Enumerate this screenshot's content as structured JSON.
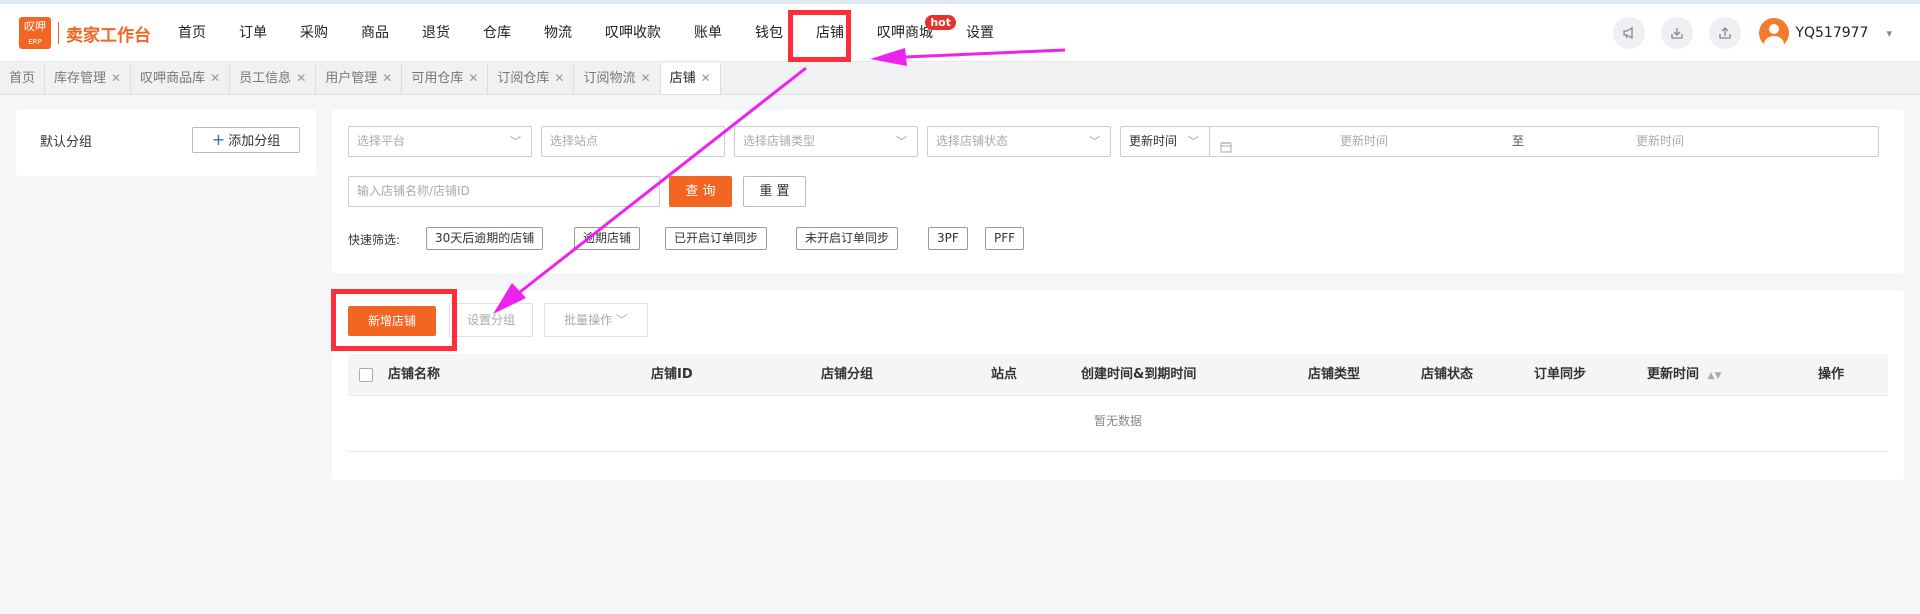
{
  "logo": {
    "mark_text": "叹呷",
    "mark_sub": "ERP",
    "title": "卖家工作台"
  },
  "nav": {
    "items": [
      {
        "label": "首页"
      },
      {
        "label": "订单"
      },
      {
        "label": "采购"
      },
      {
        "label": "商品"
      },
      {
        "label": "退货"
      },
      {
        "label": "仓库"
      },
      {
        "label": "物流"
      },
      {
        "label": "叹呷收款"
      },
      {
        "label": "账单"
      },
      {
        "label": "钱包"
      },
      {
        "label": "店铺"
      },
      {
        "label": "叹呷商城"
      },
      {
        "label": "设置"
      }
    ],
    "hot_badge": "hot",
    "username": "YQ517977",
    "icons": [
      "megaphone-icon",
      "download-icon",
      "upload-icon"
    ]
  },
  "tabs": [
    {
      "label": "首页"
    },
    {
      "label": "库存管理"
    },
    {
      "label": "叹呷商品库"
    },
    {
      "label": "员工信息"
    },
    {
      "label": "用户管理"
    },
    {
      "label": "可用仓库"
    },
    {
      "label": "订阅仓库"
    },
    {
      "label": "订阅物流"
    },
    {
      "label": "店铺"
    }
  ],
  "sidebar": {
    "group_label": "默认分组",
    "add_group": "添加分组"
  },
  "filters": {
    "platform": "选择平台",
    "site": "选择站点",
    "store_type": "选择店铺类型",
    "store_status": "选择店铺状态",
    "time_field": "更新时间",
    "start_placeholder": "更新时间",
    "range_sep": "至",
    "end_placeholder": "更新时间",
    "search_placeholder": "输入店铺名称/店铺ID",
    "query": "查 询",
    "reset": "重 置",
    "quick_label": "快速筛选:",
    "quick": [
      "30天后逾期的店铺",
      "逾期店铺",
      "已开启订单同步",
      "未开启订单同步",
      "3PF",
      "PFF"
    ]
  },
  "actions": {
    "new_store": "新增店铺",
    "set_group": "设置分组",
    "batch": "批量操作"
  },
  "table": {
    "columns": [
      "店铺名称",
      "店铺ID",
      "店铺分组",
      "站点",
      "创建时间&到期时间",
      "店铺类型",
      "店铺状态",
      "订单同步",
      "更新时间",
      "操作"
    ],
    "empty_text": "暂无数据"
  },
  "colors": {
    "accent": "#f26522",
    "highlight": "#ff2c3a",
    "arrow": "#ee22ee"
  }
}
